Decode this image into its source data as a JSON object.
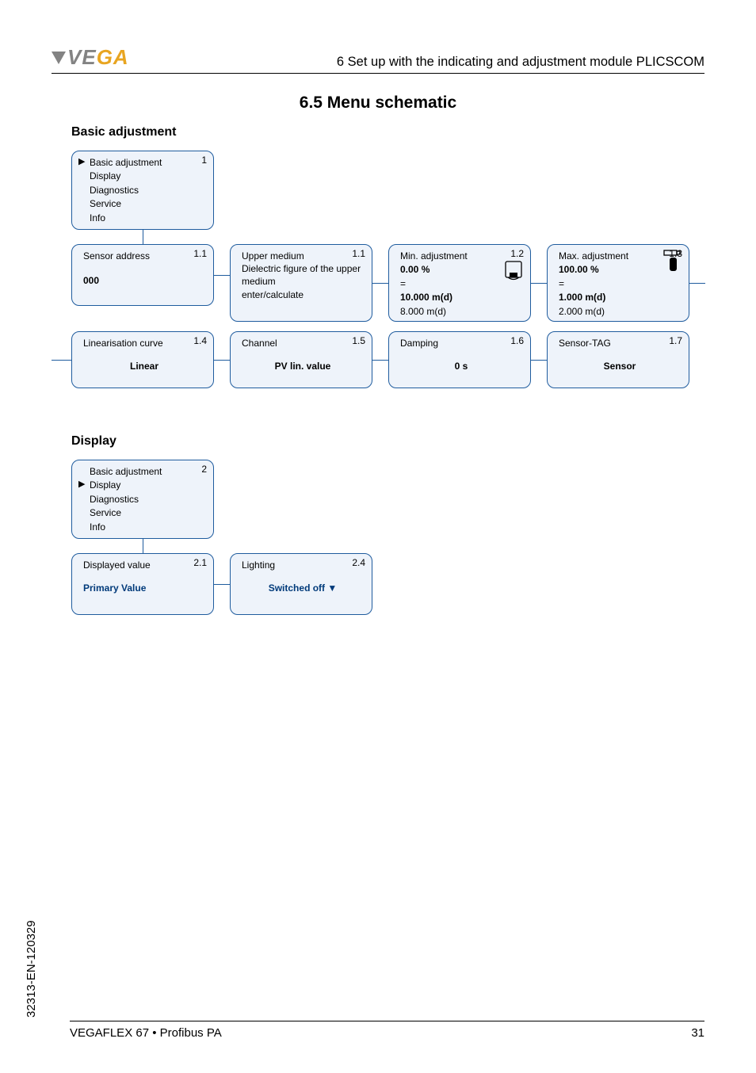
{
  "header": {
    "chapter": "6   Set up with the indicating and adjustment module PLICSCOM",
    "logo_text_1": "VE",
    "logo_text_2": "GA"
  },
  "title": "6.5   Menu schematic",
  "sections": {
    "basic": "Basic adjustment",
    "display": "Display"
  },
  "menu1": {
    "num": "1",
    "items": [
      "Basic adjustment",
      "Display",
      "Diagnostics",
      "Service",
      "Info"
    ],
    "selected_index": 0
  },
  "box_1_1a": {
    "num": "1.1",
    "title": "Sensor address",
    "value": "000"
  },
  "box_1_1b": {
    "num": "1.1",
    "l1": "Upper medium",
    "l2": "Dielectric figure of the upper medium",
    "l3": "enter/calculate"
  },
  "box_1_2": {
    "num": "1.2",
    "title": "Min. adjustment",
    "v1": "0.00 %",
    "eq": "=",
    "v2": "10.000 m(d)",
    "v3": "8.000 m(d)"
  },
  "box_1_3": {
    "num": "1.3",
    "title": "Max. adjustment",
    "v1": "100.00 %",
    "eq": "=",
    "v2": "1.000 m(d)",
    "v3": "2.000 m(d)"
  },
  "box_1_4": {
    "num": "1.4",
    "title": "Linearisation curve",
    "value": "Linear"
  },
  "box_1_5": {
    "num": "1.5",
    "title": "Channel",
    "value": "PV lin. value"
  },
  "box_1_6": {
    "num": "1.6",
    "title": "Damping",
    "value": "0 s"
  },
  "box_1_7": {
    "num": "1.7",
    "title": "Sensor-TAG",
    "value": "Sensor"
  },
  "menu2": {
    "num": "2",
    "items": [
      "Basic adjustment",
      "Display",
      "Diagnostics",
      "Service",
      "Info"
    ],
    "selected_index": 1
  },
  "box_2_1": {
    "num": "2.1",
    "title": "Displayed value",
    "value": "Primary Value"
  },
  "box_2_4": {
    "num": "2.4",
    "title": "Lighting",
    "value": "Switched off ▼"
  },
  "footer": {
    "left": "VEGAFLEX 67 • Profibus PA",
    "right": "31"
  },
  "sidecode": "32313-EN-120329"
}
